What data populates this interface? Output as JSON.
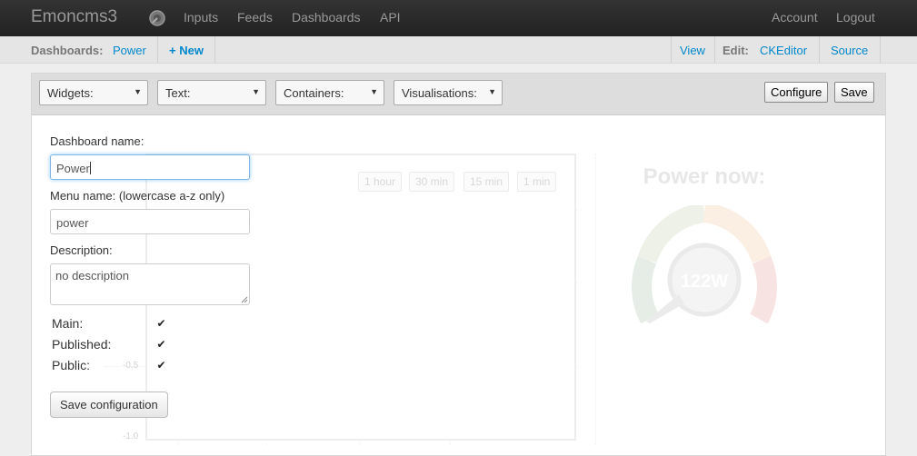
{
  "nav": {
    "brand": "Emoncms3",
    "links": [
      "Inputs",
      "Feeds",
      "Dashboards",
      "API"
    ],
    "account": "Account",
    "logout": "Logout"
  },
  "subnav": {
    "dashboards_label": "Dashboards:",
    "power": "Power",
    "new": "+ New",
    "view": "View",
    "edit_label": "Edit:",
    "ckeditor": "CKEditor",
    "source": "Source"
  },
  "toolbar": {
    "selects": [
      "Widgets:",
      "Text:",
      "Containers:",
      "Visualisations:"
    ],
    "configure": "Configure",
    "save": "Save"
  },
  "background": {
    "ranges": [
      "1 hour",
      "30 min",
      "15 min",
      "1 min"
    ],
    "y_ticks": [
      "-0.5",
      "-1.0"
    ],
    "widget_title": "Power now:",
    "gauge_value": "122W"
  },
  "form": {
    "name_label": "Dashboard name:",
    "name_value": "Power",
    "menu_label": "Menu name: (lowercase a-z only)",
    "menu_value": "power",
    "description_label": "Description:",
    "description_value": "no description",
    "main_label": "Main:",
    "published_label": "Published:",
    "public_label": "Public:",
    "main_checked": true,
    "published_checked": true,
    "public_checked": true,
    "save_button": "Save configuration"
  },
  "colors": {
    "link": "#0088cc",
    "topbar": "#222222"
  }
}
